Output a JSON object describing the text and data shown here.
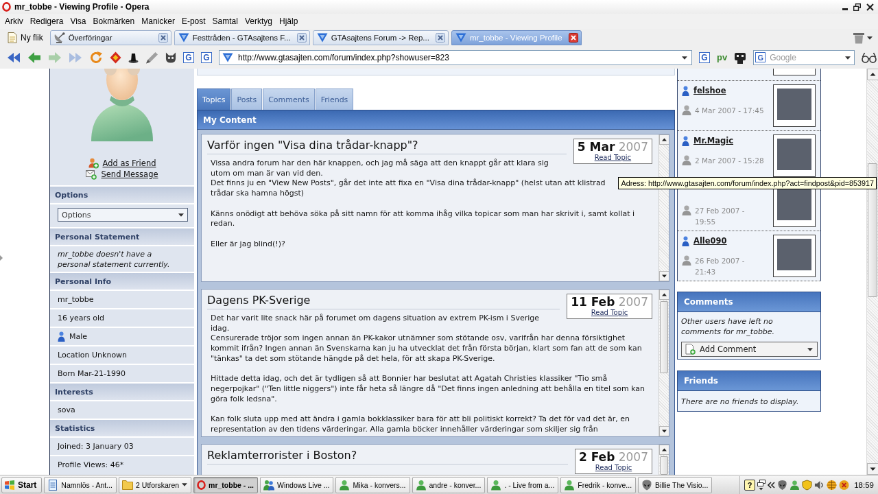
{
  "window": {
    "title": "mr_tobbe - Viewing Profile - Opera"
  },
  "menu": [
    "Arkiv",
    "Redigera",
    "Visa",
    "Bokmärken",
    "Manicker",
    "E-post",
    "Samtal",
    "Verktyg",
    "Hjälp"
  ],
  "new_tab": "Ny flik",
  "tabs": [
    {
      "label": "Överföringar",
      "kind": "transfers",
      "selected": false
    },
    {
      "label": "Festtråden - GTAsajtens F...",
      "kind": "page",
      "selected": false
    },
    {
      "label": "GTAsajtens Forum -> Rep...",
      "kind": "page",
      "selected": false
    },
    {
      "label": "mr_tobbe - Viewing Profile",
      "kind": "page",
      "selected": true
    }
  ],
  "toolbar": {
    "left_buttons": [
      "G",
      "G"
    ],
    "address": "http://www.gtasajten.com/forum/index.php?showuser=823",
    "right_buttons": [
      {
        "label": "G",
        "kind": "boxed"
      },
      {
        "label": "pv",
        "kind": "plain"
      }
    ],
    "search": {
      "engine": "G",
      "placeholder": "Google"
    }
  },
  "sidebar": {
    "links": [
      {
        "label": "Add as Friend",
        "kind": "friend"
      },
      {
        "label": "Send Message",
        "kind": "message"
      }
    ],
    "sections": [
      {
        "title": "Options",
        "kind": "dropdown",
        "value": "Options"
      },
      {
        "title": "Personal Statement",
        "kind": "note",
        "text": "mr_tobbe doesn't have a personal statement currently."
      },
      {
        "title": "Personal Info",
        "kind": "rows",
        "rows": [
          {
            "text": "mr_tobbe",
            "kind": "plain"
          },
          {
            "text": "16 years old",
            "kind": "plain"
          },
          {
            "text": "Male",
            "kind": "gender"
          },
          {
            "text": "Location Unknown",
            "kind": "plain"
          },
          {
            "text": "Born Mar-21-1990",
            "kind": "plain"
          }
        ]
      },
      {
        "title": "Interests",
        "kind": "rows",
        "rows": [
          {
            "text": "sova",
            "kind": "plain"
          }
        ]
      },
      {
        "title": "Statistics",
        "kind": "rows",
        "rows": [
          {
            "text": "Joined: 3 January 03",
            "kind": "plain"
          },
          {
            "text": "Profile Views: 46*",
            "kind": "plain"
          }
        ]
      }
    ]
  },
  "content": {
    "tabs": [
      {
        "label": "Topics",
        "selected": true
      },
      {
        "label": "Posts",
        "selected": false
      },
      {
        "label": "Comments",
        "selected": false
      },
      {
        "label": "Friends",
        "selected": false
      }
    ],
    "header": "My Content",
    "topics": [
      {
        "title": "Varför ingen \"Visa dina trådar-knapp\"?",
        "day": "5 Mar",
        "year": "2007",
        "link": "Read Topic",
        "overflowing": false,
        "paragraphs": [
          [
            "Vissa andra forum har den här knappen, och jag må säga att den knappt går att klara sig utom om man är van vid den.",
            "Det finns ju en \"View New Posts\", går det inte att fixa en \"Visa dina trådar-knapp\" (helst utan att klistrad",
            "trådar ska hamna högst)"
          ],
          [
            "Känns onödigt att behöva söka på sitt namn för att komma ihåg vilka topicar som man har skrivit i, samt kollat i redan."
          ],
          [
            "Eller är jag blind(!)?"
          ]
        ]
      },
      {
        "title": "Dagens PK-Sverige",
        "day": "11 Feb",
        "year": "2007",
        "link": "Read Topic",
        "overflowing": true,
        "paragraphs": [
          [
            "Det har varit lite snack här på forumet om dagens situation av extrem PK-ism i Sverige idag.",
            "Censurerade tröjor som ingen annan än PK-kakor utnämner som stötande osv, varifrån har denna försiktighet kommit ifrån? Ingen annan än Svenskarna kan ju ha utvecklat det från första början, klart som fan att de som kan \"tänkas\" ta det som stötande hängde på det hela, för att skapa PK-Sverige."
          ],
          [
            "Hittade detta idag, och det är tydligen så att Bonnier har beslutat att Agatah Christies klassiker \"Tio små negerpojkar\" (\"Ten little niggers\") inte får heta så längre då \"Det finns ingen anledning att behålla en titel som kan göra folk ledsna\"."
          ],
          [
            "Kan folk sluta upp med att ändra i gamla bokklassiker bara för att bli politiskt korrekt? Ta det för vad det är, en representation av den tidens värderingar. Alla gamla böcker innehåller värderingar som skiljer sig från"
          ]
        ]
      },
      {
        "title": "Reklamterrorister i Boston?",
        "day": "2 Feb",
        "year": "2007",
        "link": "Read Topic",
        "overflowing": true
      }
    ]
  },
  "user_list": {
    "entries": [
      {
        "name": "felshoe",
        "date": "4 Mar 2007 - 17:45"
      },
      {
        "name": "Mr.Magic",
        "date": "2 Mar 2007 - 15:28"
      },
      {
        "date": "27 Feb 2007 - 19:55"
      },
      {
        "name": "Alle090",
        "date": "26 Feb 2007 - 21:43"
      }
    ]
  },
  "comments": {
    "title": "Comments",
    "text": "Other users have left no comments for mr_tobbe.",
    "action": "Add Comment"
  },
  "friends": {
    "title": "Friends",
    "text": "There are no friends to display."
  },
  "tooltip": "Adress: http://www.gtasajten.com/forum/index.php?act=findpost&pid=853917",
  "taskbar": {
    "start": "Start",
    "items": [
      {
        "label": "Namnlös - Ant...",
        "kind": "notepad",
        "grouped": false,
        "selected": false
      },
      {
        "label": "2 Utforskaren",
        "kind": "folder",
        "grouped": true,
        "selected": false
      },
      {
        "label": "mr_tobbe - ...",
        "kind": "browser",
        "grouped": false,
        "selected": true
      },
      {
        "label": "Windows Live ...",
        "kind": "messenger",
        "grouped": false,
        "selected": false
      },
      {
        "label": "Mika - konvers...",
        "kind": "chat",
        "grouped": false,
        "selected": false
      },
      {
        "label": "andre - konver...",
        "kind": "chat",
        "grouped": false,
        "selected": false
      },
      {
        "label": ". - Live from a...",
        "kind": "chat",
        "grouped": false,
        "selected": false
      },
      {
        "label": "Fredrik - konve...",
        "kind": "chat",
        "grouped": false,
        "selected": false
      },
      {
        "label": "Billie The Visio...",
        "kind": "media",
        "grouped": false,
        "selected": false
      }
    ],
    "help": "?",
    "clock": "18:59"
  }
}
